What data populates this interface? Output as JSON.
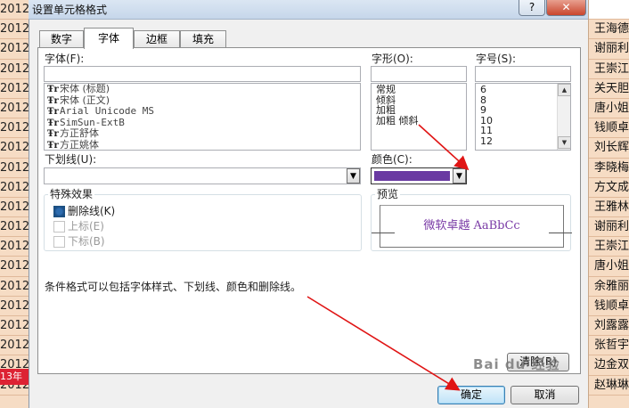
{
  "window": {
    "title": "设置单元格格式",
    "help": "?",
    "close": "✕"
  },
  "tabs": [
    "数字",
    "字体",
    "边框",
    "填充"
  ],
  "font": {
    "label": "字体(F):",
    "value": "",
    "items": [
      "宋体 (标题)",
      "宋体 (正文)",
      "Arial Unicode MS",
      "SimSun-ExtB",
      "方正舒体",
      "方正姚体"
    ]
  },
  "style": {
    "label": "字形(O):",
    "value": "",
    "items": [
      "常规",
      "倾斜",
      "加粗",
      "加粗 倾斜"
    ]
  },
  "size": {
    "label": "字号(S):",
    "value": "",
    "items": [
      "6",
      "8",
      "9",
      "10",
      "11",
      "12"
    ]
  },
  "underline": {
    "label": "下划线(U):",
    "value": ""
  },
  "color": {
    "label": "颜色(C):",
    "value": "#6a3aa2"
  },
  "effects": {
    "title": "特殊效果",
    "strike": "删除线(K)",
    "superscript": "上标(E)",
    "subscript": "下标(B)"
  },
  "preview": {
    "title": "预览",
    "sample": "微软卓越  AaBbCc",
    "color": "#7a3ba6"
  },
  "note": "条件格式可以包括字体样式、下划线、颜色和删除线。",
  "clear_label": "清除(R)",
  "ok_label": "确定",
  "cancel_label": "取消",
  "watermark": "Bai du 经验",
  "background": {
    "left_cells": [
      "2012",
      "2012",
      "2012",
      "2012",
      "2012",
      "2012",
      "2012",
      "2012",
      "2012",
      "2012",
      "2012",
      "2012",
      "2012",
      "2012",
      "2012",
      "2012",
      "2012",
      "2012",
      "2012",
      "2012"
    ],
    "left_tab": "13年",
    "right_cells": [
      "",
      "王海德",
      "谢丽利",
      "王崇江",
      "关天胆",
      "唐小姐",
      "钱顺卓",
      "刘长辉",
      "李晓梅",
      "方文成",
      "王雅林",
      "谢丽利",
      "王崇江",
      "唐小姐",
      "余雅丽",
      "钱顺卓",
      "刘露露",
      "张哲宇",
      "边金双",
      "赵琳琳"
    ]
  }
}
